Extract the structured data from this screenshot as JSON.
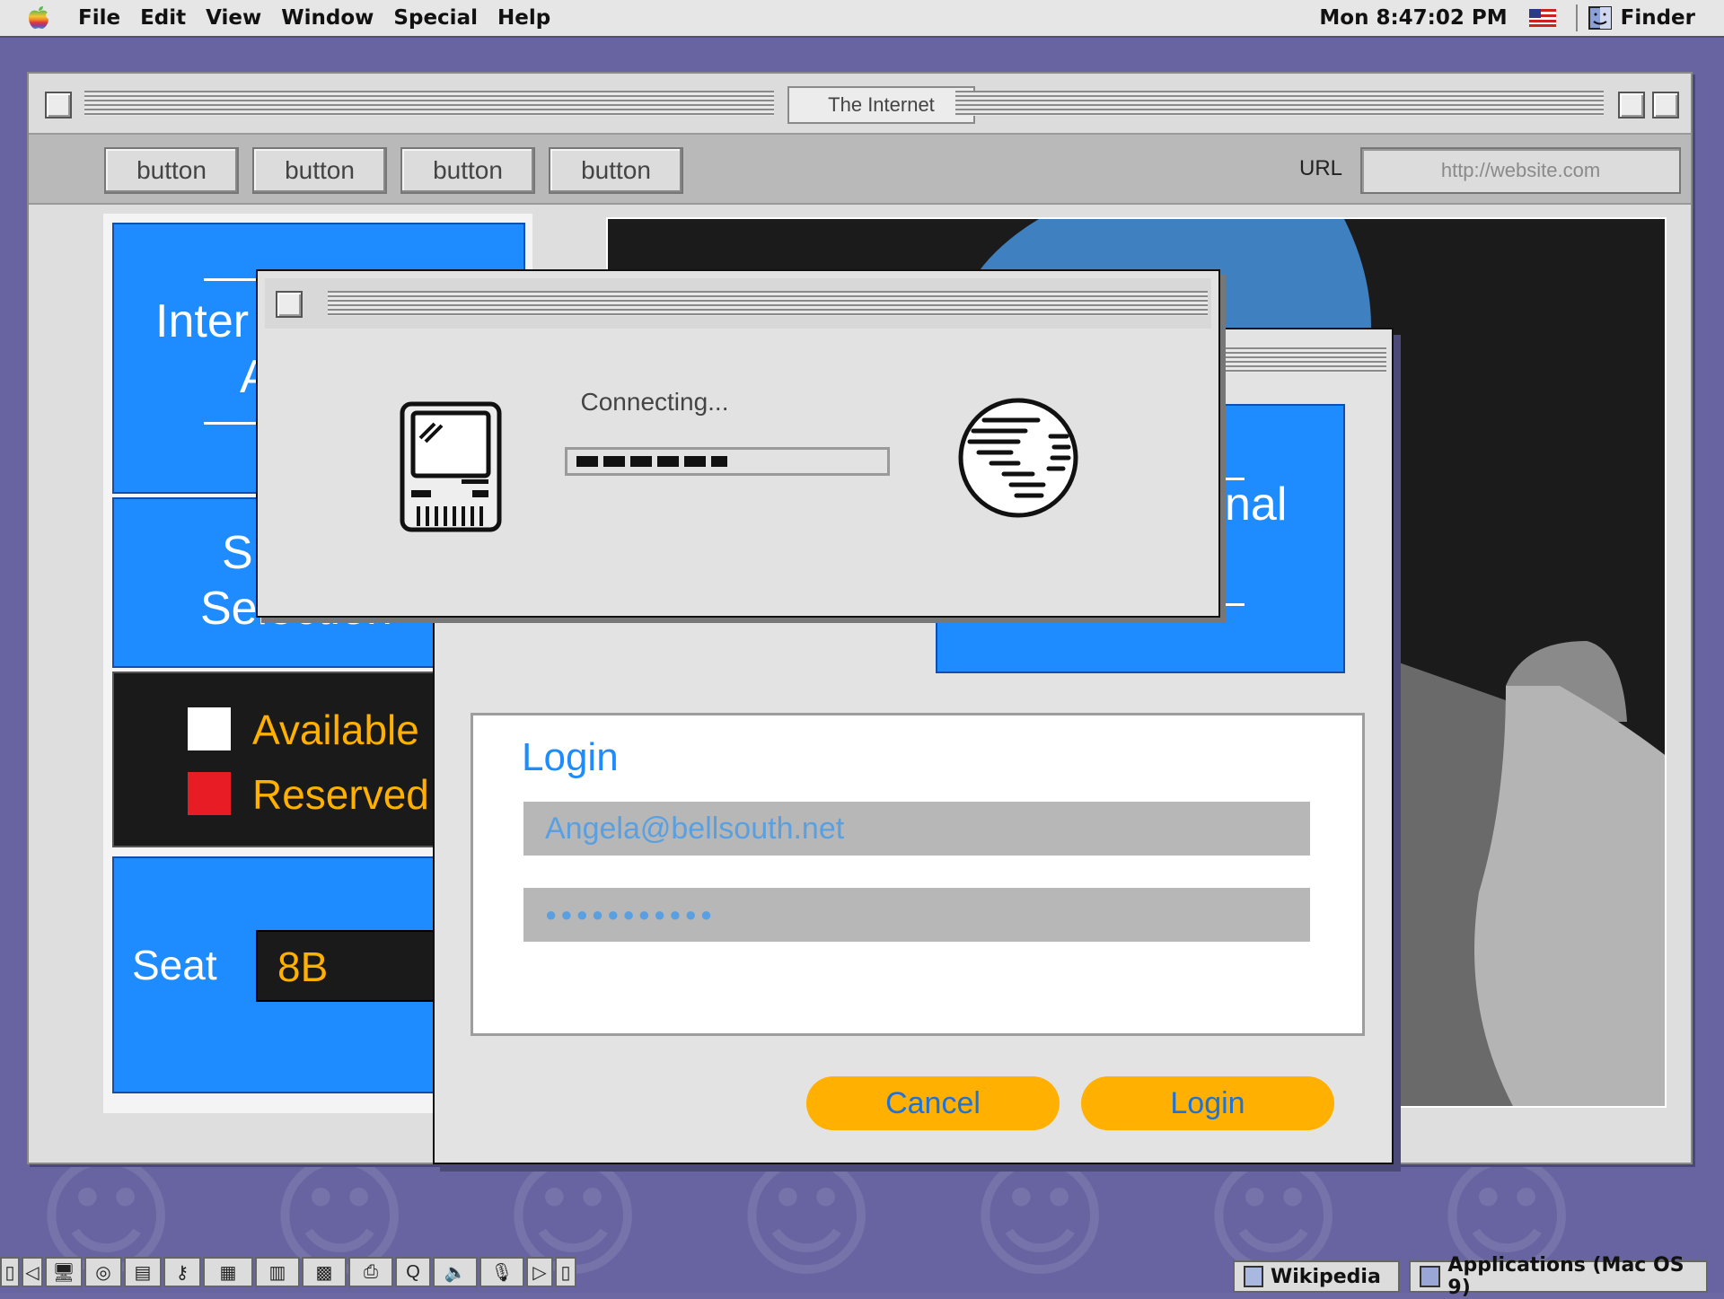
{
  "menubar": {
    "items": [
      "File",
      "Edit",
      "View",
      "Window",
      "Special",
      "Help"
    ],
    "clock": "Mon 8:47:02 PM",
    "app": "Finder"
  },
  "main_window": {
    "title": "The Internet",
    "toolbar_buttons": [
      "button",
      "button",
      "button",
      "button"
    ],
    "url_label": "URL",
    "url_placeholder": "http://website.com"
  },
  "left_panel": {
    "card1": {
      "line1": "Inter",
      "line2": "A"
    },
    "card2": {
      "line1": "S",
      "line2": "Selection"
    },
    "legend": {
      "available": "Available",
      "reserved": "Reserved"
    },
    "seat": {
      "label": "Seat",
      "value": "8B"
    }
  },
  "back_dialog": {
    "card_fragment": "nal",
    "login": {
      "title": "Login",
      "email": "Angela@bellsouth.net",
      "password": "●●●●●●●●●●●"
    },
    "cancel_label": "Cancel",
    "login_label": "Login"
  },
  "connect_dialog": {
    "status": "Connecting...",
    "progress": 0.5
  },
  "taskbar": {
    "apps": [
      "Wikipedia",
      "Applications (Mac OS 9)"
    ]
  },
  "colors": {
    "desktop": "#6764a1",
    "accent_blue": "#1e8cff",
    "button_orange": "#ffb000",
    "legend_text": "#ffb000",
    "reserved_red": "#e81c24"
  },
  "icons": [
    "apple-logo-icon",
    "us-flag-icon",
    "finder-icon",
    "classic-mac-icon",
    "globe-icon"
  ]
}
